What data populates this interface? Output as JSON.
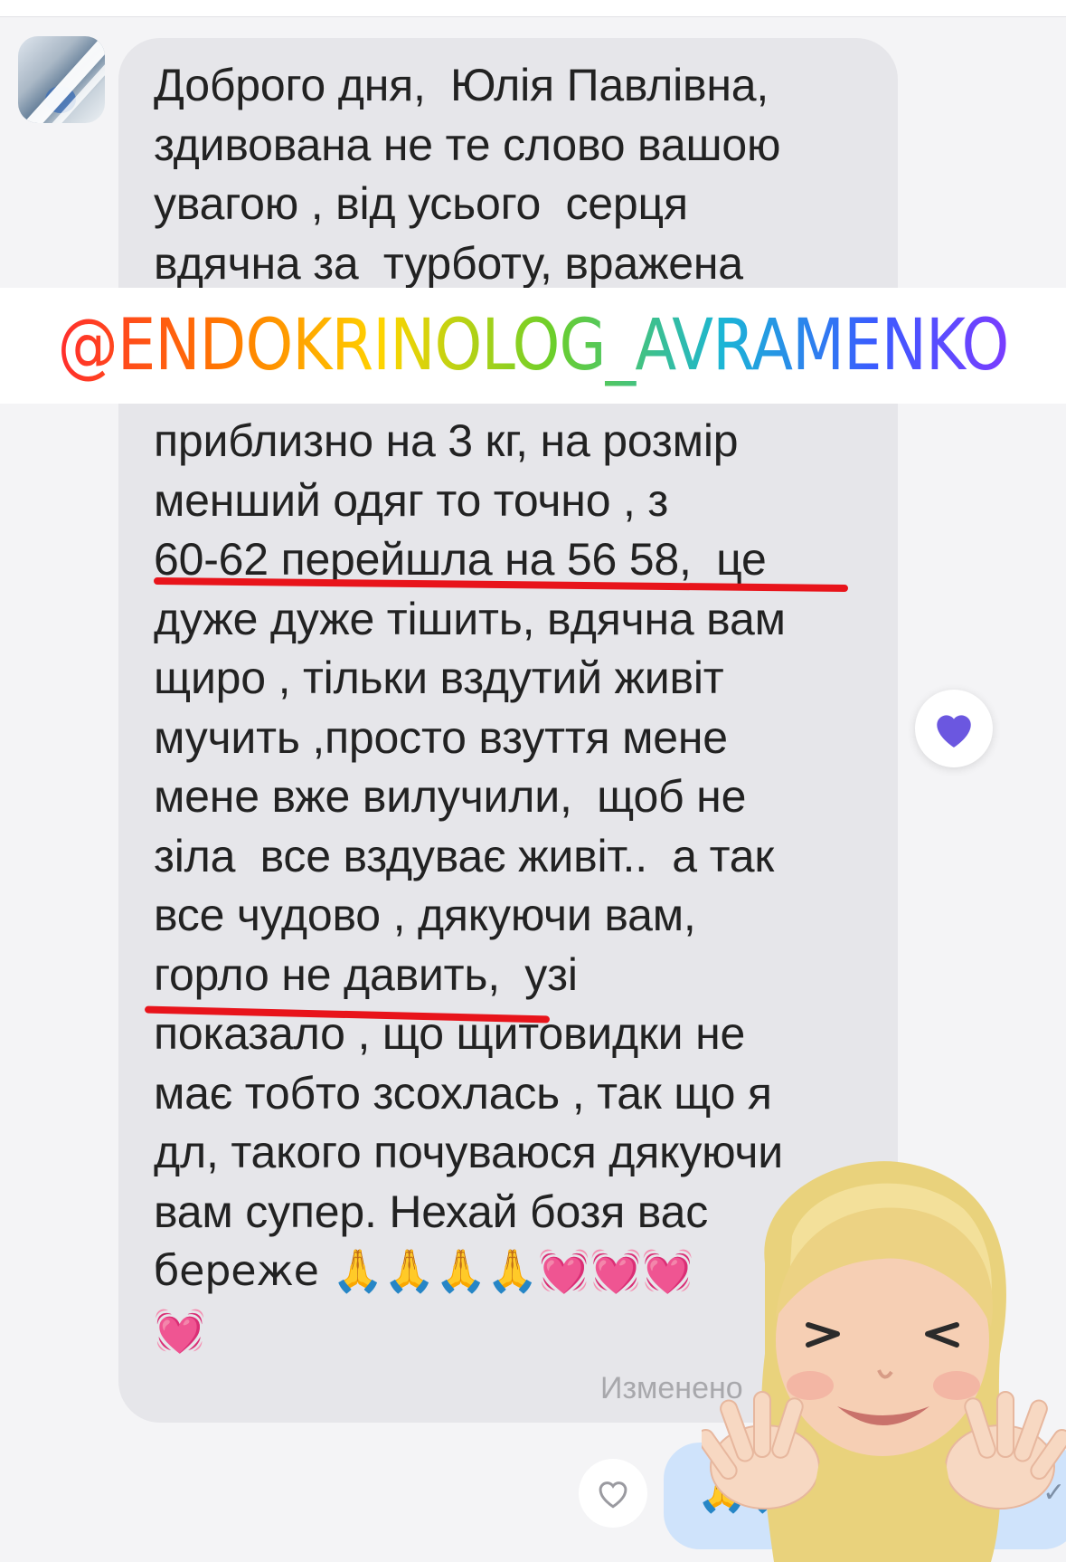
{
  "chat": {
    "message_lines": [
      "Доброго дня,  Юлія Павлівна,",
      "здивована не те слово вашою",
      "увагою , від усього  серця",
      "вдячна за  турботу, вражена",
      "",
      "",
      "приблизно на 3 кг, на розмір",
      "менший одяг то точно , з",
      "60-62 перейшла на 56 58,  це",
      "дуже дуже тішить, вдячна вам",
      "щиро , тільки вздутий живіт",
      "мучить ,просто взуття мене",
      "мене вже вилучили,  щоб не",
      "зіла  все вздуває живіт..  а так",
      "все чудово , дякуючи вам,",
      "горло не давить,  узі",
      "показало , що щитовидки не",
      "має тобто зсохлась , так що я",
      "дл, такого почуваюся дякуючи",
      "вам супер. Нехай бозя вас",
      "береже 🙏🙏🙏🙏💓💓💓",
      "💓"
    ],
    "edited_label": "Изменено",
    "outgoing_text": "🙏🙏🙏",
    "read_ticks": "✓✓"
  },
  "overlay": {
    "handle": "@ENDOKRINOLOG_AVRAMENKO"
  },
  "reactions": {
    "incoming": "purple-heart-icon",
    "outgoing_like": "heart-outline-icon"
  },
  "colors": {
    "bubble_incoming": "#e6e6ea",
    "bubble_outgoing": "#cfe3fb",
    "underline": "#e8141b",
    "reaction_heart": "#6b57e0"
  }
}
